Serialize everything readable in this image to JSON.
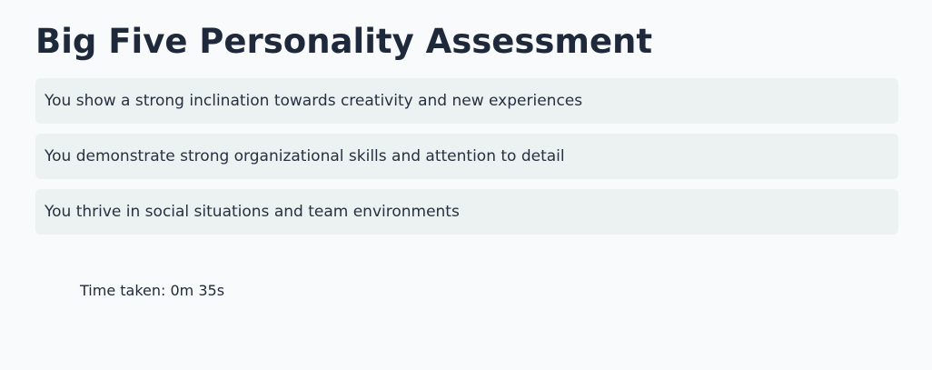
{
  "page": {
    "title": "Big Five Personality Assessment"
  },
  "results": [
    {
      "text": "You show a strong inclination towards creativity and new experiences"
    },
    {
      "text": "You demonstrate strong organizational skills and attention to detail"
    },
    {
      "text": "You thrive in social situations and team environments"
    }
  ],
  "summary": {
    "time_taken": "Time taken: 0m 35s"
  },
  "colors": {
    "background": "#f8fafc",
    "card_background": "#ecf1f1",
    "title_text": "#1e293b",
    "body_text": "#263241"
  }
}
